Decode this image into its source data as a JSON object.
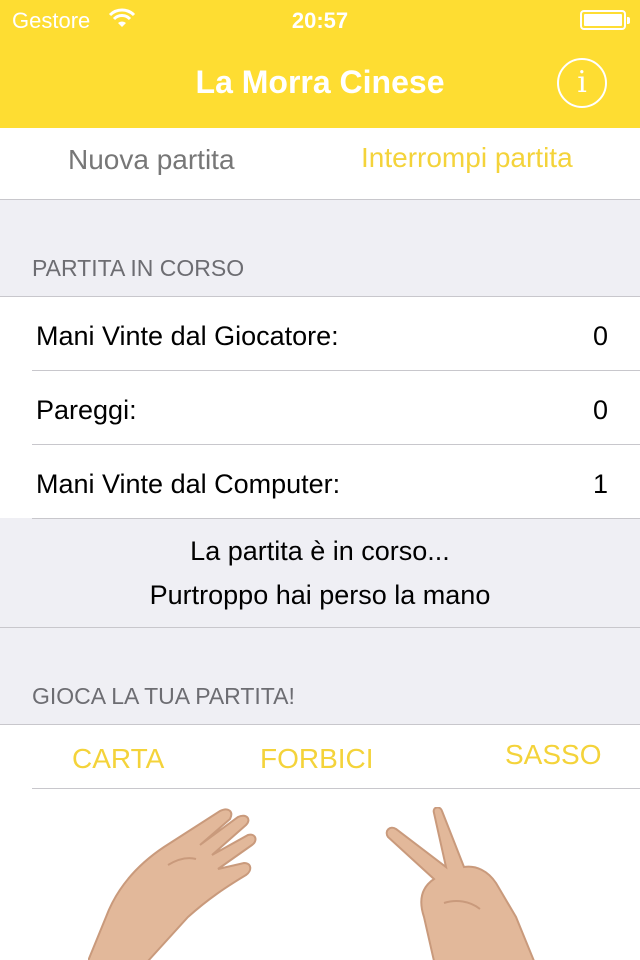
{
  "status_bar": {
    "carrier": "Gestore",
    "time": "20:57",
    "battery_level": 1.0
  },
  "header": {
    "title": "La Morra Cinese",
    "info_icon": "info-icon"
  },
  "toolbar": {
    "new_game": "Nuova partita",
    "stop_game": "Interrompi partita"
  },
  "current_game": {
    "section_title": "PARTITA IN CORSO",
    "rows": [
      {
        "label": "Mani Vinte dal Giocatore:",
        "value": "0"
      },
      {
        "label": "Pareggi:",
        "value": "0"
      },
      {
        "label": "Mani Vinte dal Computer:",
        "value": "1"
      }
    ]
  },
  "message": {
    "line1": "La partita è in corso...",
    "line2": "Purtroppo hai perso la mano"
  },
  "play": {
    "section_title": "GIOCA LA TUA PARTITA!",
    "choices": {
      "paper": "CARTA",
      "scissors": "FORBICI",
      "rock": "SASSO"
    },
    "hand_icons": [
      "paper-hand-icon",
      "scissors-hand-icon"
    ]
  },
  "colors": {
    "accent": "#fedd32",
    "accent_text": "#f4d33a",
    "background": "#efeff4"
  }
}
